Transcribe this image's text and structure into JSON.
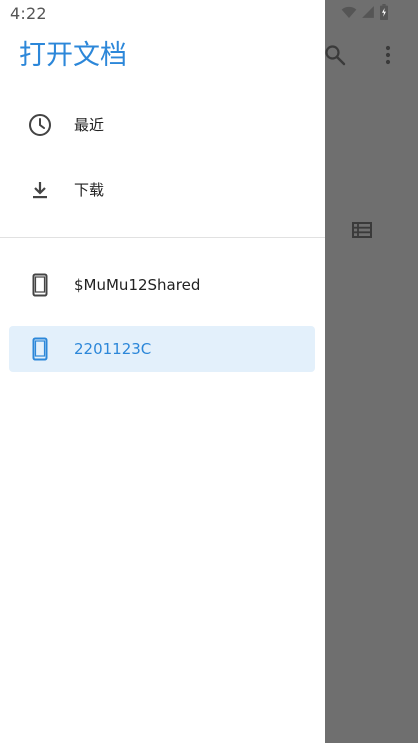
{
  "status_bar": {
    "time": "4:22",
    "icons": [
      "wifi-icon",
      "signal-icon",
      "battery-icon"
    ]
  },
  "drawer": {
    "title": "打开文档",
    "recents": [
      {
        "label": "最近",
        "icon": "clock-icon"
      },
      {
        "label": "下载",
        "icon": "download-icon"
      }
    ],
    "roots": [
      {
        "label": "$MuMu12Shared",
        "icon": "phone-icon",
        "selected": false
      },
      {
        "label": "2201123C",
        "icon": "phone-icon",
        "selected": true
      }
    ]
  },
  "app_bar": {
    "icons": [
      "search-icon",
      "more-vert-icon"
    ],
    "view_toggle_icon": "list-view-icon"
  },
  "colors": {
    "accent": "#2c87d9",
    "selected_bg": "#e3f0fb",
    "scrim": "#6f6f6f",
    "icon": "#555555"
  }
}
